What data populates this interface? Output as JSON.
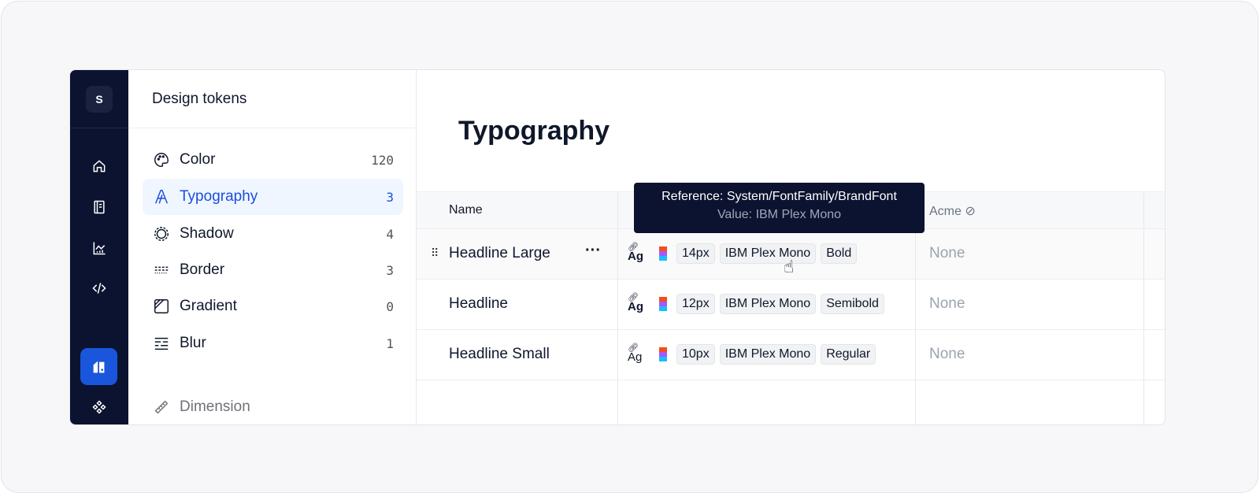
{
  "rail": {
    "logo": "S",
    "icons": [
      "home-icon",
      "book-icon",
      "chart-icon",
      "code-icon",
      "tokens-icon",
      "components-icon"
    ]
  },
  "panel": {
    "title": "Design tokens",
    "items": [
      {
        "label": "Color",
        "count": "120",
        "icon": "palette-icon"
      },
      {
        "label": "Typography",
        "count": "3",
        "icon": "typography-icon",
        "active": true
      },
      {
        "label": "Shadow",
        "count": "4",
        "icon": "shadow-icon"
      },
      {
        "label": "Border",
        "count": "3",
        "icon": "border-icon"
      },
      {
        "label": "Gradient",
        "count": "0",
        "icon": "gradient-icon"
      },
      {
        "label": "Blur",
        "count": "1",
        "icon": "blur-icon"
      },
      {
        "label": "Dimension",
        "icon": "ruler-icon"
      }
    ]
  },
  "main": {
    "title": "Typography",
    "columns": {
      "name": "Name",
      "acme": "Acme"
    },
    "rows": [
      {
        "name": "Headline Large",
        "size": "14px",
        "family": "IBM Plex Mono",
        "weight": "Bold",
        "acme": "None"
      },
      {
        "name": "Headline",
        "size": "12px",
        "family": "IBM Plex Mono",
        "weight": "Semibold",
        "acme": "None"
      },
      {
        "name": "Headline Small",
        "size": "10px",
        "family": "IBM Plex Mono",
        "weight": "Regular",
        "acme": "None"
      }
    ],
    "ag": "Ag"
  },
  "tooltip": {
    "reference": "Reference: System/FontFamily/BrandFont",
    "value": "Value: IBM Plex Mono"
  },
  "colors": {
    "rail": "#0b1330",
    "accent": "#1d4ed8",
    "active_bg": "#eff6ff"
  }
}
